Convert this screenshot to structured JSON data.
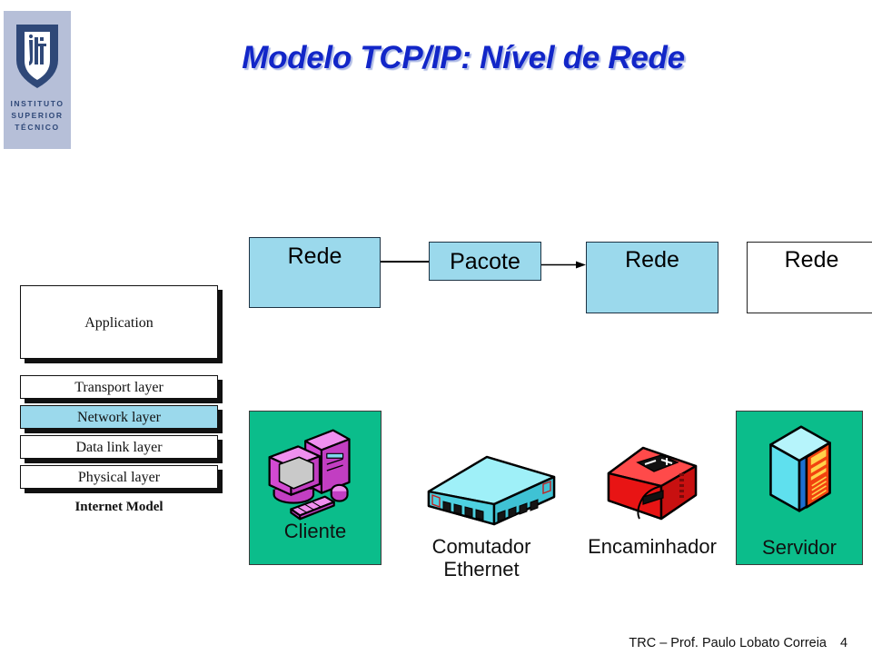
{
  "logo": {
    "shield_icon": "ist-shield-icon",
    "line1": "INSTITUTO",
    "line2": "SUPERIOR",
    "line3": "TÉCNICO",
    "panel_color": "#b6bfd8",
    "shield_color": "#2f4878"
  },
  "title": {
    "text": "Modelo TCP/IP: Nível de Rede",
    "color": "#1226c8"
  },
  "flow": {
    "box1": "Rede",
    "box2": "Pacote",
    "box3": "Rede",
    "box4": "Rede",
    "fill_color": "#9bd9ec",
    "connector_icon": "arrow-right-icon"
  },
  "stack": {
    "layers": [
      {
        "label": "Application",
        "highlighted": false
      },
      {
        "label": "Transport layer",
        "highlighted": false
      },
      {
        "label": "Network layer",
        "highlighted": true
      },
      {
        "label": "Data link layer",
        "highlighted": false
      },
      {
        "label": "Physical layer",
        "highlighted": false
      }
    ],
    "caption": "Internet Model",
    "highlight_color": "#9bd9ec"
  },
  "devices": {
    "client": {
      "label": "Cliente",
      "icon": "desktop-computer-icon",
      "panel_color": "#0bbd8b",
      "icon_color": "#e040e0"
    },
    "switch": {
      "label": "Comutador\nEthernet",
      "icon": "ethernet-switch-icon",
      "icon_color": "#5fe0ee"
    },
    "router": {
      "label": "Encaminhador",
      "icon": "router-icon",
      "icon_color": "#f22020"
    },
    "server": {
      "label": "Servidor",
      "icon": "server-rack-icon",
      "panel_color": "#0bbd8b",
      "icon_color": "#5fe0ee"
    }
  },
  "footer": {
    "text": "TRC – Prof. Paulo Lobato Correia",
    "page": "4"
  }
}
